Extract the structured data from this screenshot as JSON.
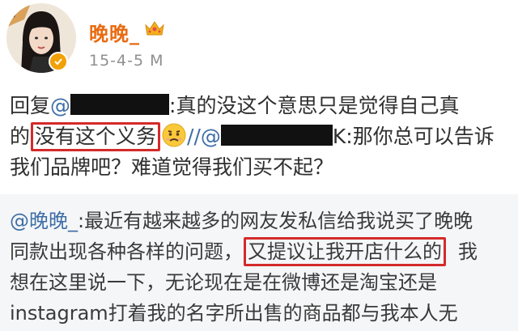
{
  "post": {
    "username": "晚晚_",
    "timestamp": "15-4-5 M",
    "lines": [
      {
        "prefix": "回复",
        "mention": "@",
        "after_redact": ":真的没这个意思只是觉得自己真"
      },
      {
        "start": "的",
        "boxed": "没有这个义务",
        "forward": "//@",
        "after": "K:那你总可以告诉"
      },
      {
        "text": "我们品牌吧？难道觉得我们买不起？"
      }
    ]
  },
  "forwarded": {
    "mention": "@晚晚_",
    "lines": [
      {
        "after_mention": ":最近有越来越多的网友发私信给我说买了晚晚"
      },
      {
        "start": "同款出现各种各样的问题，",
        "boxed": "又提议让我开店什么的",
        "end": "我"
      },
      {
        "text": "想在这里说一下，无论现在是在微博还是淘宝还是"
      },
      {
        "text": "instagram打着我的名字所出售的商品都与我本人无"
      }
    ]
  },
  "colors": {
    "username": "#e86b12",
    "mention": "#3e6ea6",
    "highlight_box": "#d42a2a",
    "redaction": "#111111",
    "forwarded_bg": "#f5f6f8"
  },
  "icons": [
    "avatar-image",
    "verified-badge-icon",
    "crown-icon",
    "worried-face-emoji-icon"
  ]
}
